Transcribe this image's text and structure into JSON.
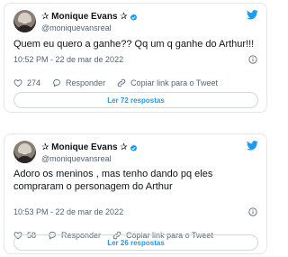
{
  "colors": {
    "accent": "#1d9bf0",
    "heart": "#536471",
    "verified": "#1d9bf0",
    "text_primary": "#0f1419",
    "text_secondary": "#536471",
    "border": "#e1e8ed"
  },
  "tweets": [
    {
      "display_name": "✰ Monique Evans ✰",
      "handle": "@moniquevansreal",
      "text": "Quem eu quero a ganhe?? Qq um q ganhe do Arthur!!!",
      "timestamp": "10:52 PM - 22 de mar de 2022",
      "likes": "274",
      "reply_label": "Responder",
      "copy_label": "Copiar link para o Tweet",
      "read_replies_label": "Ler 72 respostas"
    },
    {
      "display_name": "✰ Monique Evans ✰",
      "handle": "@moniquevansreal",
      "text": "Adoro os meninos , mas tenho dando pq eles compraram o personagem do Arthur",
      "timestamp": "10:53 PM - 22 de mar de 2022",
      "likes": "58",
      "reply_label": "Responder",
      "copy_label": "Copiar link para o Tweet",
      "read_replies_label": "Ler 26 respostas"
    }
  ]
}
